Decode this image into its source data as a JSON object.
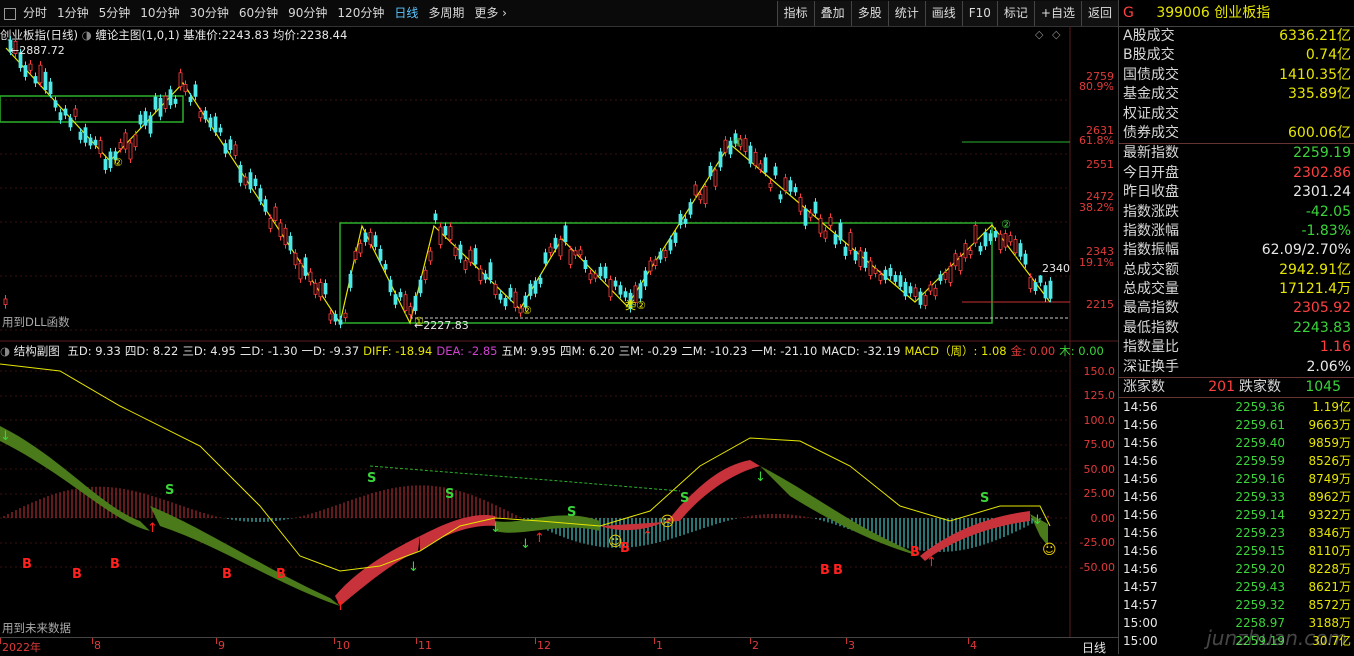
{
  "toolbar": {
    "periods": [
      "分时",
      "1分钟",
      "5分钟",
      "10分钟",
      "30分钟",
      "60分钟",
      "90分钟",
      "120分钟",
      "日线",
      "多周期",
      "更多"
    ],
    "active_period": "日线",
    "buttons": [
      "指标",
      "叠加",
      "多股",
      "统计",
      "画线",
      "F10",
      "标记",
      "+自选",
      "返回"
    ]
  },
  "main_chart": {
    "title": "创业板指(日线)",
    "indicator": "缠论主图(1,0,1)",
    "base_price_label": "基准价:",
    "base_price": "2243.83",
    "avg_label": "均价:",
    "avg_price": "2238.44",
    "high_mark": "2887.72",
    "low_mark": "2227.83",
    "last_price_tag": "2340",
    "price_axis": [
      "2759",
      "2631",
      "2551",
      "2472",
      "2343",
      "2215"
    ],
    "pct_axis": [
      "80.9%",
      "61.8%",
      "38.2%",
      "19.1%"
    ],
    "dll_note": "用到DLL函数",
    "zigzag_marks": [
      "②",
      "①",
      "②",
      "②",
      "类②",
      "①",
      "②"
    ]
  },
  "sub_chart": {
    "title": "结构副图",
    "items": [
      {
        "label": "五D:",
        "value": "9.33",
        "color": "#e6e6e6"
      },
      {
        "label": "四D:",
        "value": "8.22",
        "color": "#e6e6e6"
      },
      {
        "label": "三D:",
        "value": "4.95",
        "color": "#e6e6e6"
      },
      {
        "label": "二D:",
        "value": "-1.30",
        "color": "#e6e6e6"
      },
      {
        "label": "一D:",
        "value": "-9.37",
        "color": "#e6e6e6"
      },
      {
        "label": "DIFF:",
        "value": "-18.94",
        "color": "#e6e600"
      },
      {
        "label": "DEA:",
        "value": "-2.85",
        "color": "#d040d0"
      },
      {
        "label": "五M:",
        "value": "9.95",
        "color": "#e6e6e6"
      },
      {
        "label": "四M:",
        "value": "6.20",
        "color": "#e6e6e6"
      },
      {
        "label": "三M:",
        "value": "-0.29",
        "color": "#e6e6e6"
      },
      {
        "label": "二M:",
        "value": "-10.23",
        "color": "#e6e6e6"
      },
      {
        "label": "一M:",
        "value": "-21.10",
        "color": "#e6e6e6"
      },
      {
        "label": "MACD:",
        "value": "-32.19",
        "color": "#e6e6e6"
      },
      {
        "label": "MACD（周）:",
        "value": "1.08",
        "color": "#e6e600"
      },
      {
        "label": "金:",
        "value": "0.00",
        "color": "#e03a3a"
      },
      {
        "label": "木:",
        "value": "0.00",
        "color": "#3ad43a"
      }
    ],
    "axis": [
      "150.0",
      "125.0",
      "100.0",
      "75.00",
      "50.00",
      "25.00",
      "0.00",
      "-25.00",
      "-50.00"
    ],
    "future_note": "用到未来数据"
  },
  "time_axis": {
    "labels": [
      "2022年",
      "8",
      "9",
      "10",
      "11",
      "12",
      "1",
      "2",
      "3",
      "4"
    ],
    "period_label": "日线"
  },
  "right_panel": {
    "code_prefix": "G",
    "code": "399006",
    "name": "创业板指",
    "market_rows": [
      {
        "label": "A股成交",
        "value": "6336.21亿",
        "color": "#e6e600"
      },
      {
        "label": "B股成交",
        "value": "0.74亿",
        "color": "#e6e600"
      },
      {
        "label": "国债成交",
        "value": "1410.35亿",
        "color": "#e6e600"
      },
      {
        "label": "基金成交",
        "value": "335.89亿",
        "color": "#e6e600"
      },
      {
        "label": "权证成交",
        "value": "",
        "color": "#e6e600"
      },
      {
        "label": "债券成交",
        "value": "600.06亿",
        "color": "#e6e600"
      }
    ],
    "quote_rows": [
      {
        "label": "最新指数",
        "value": "2259.19",
        "color": "#3ad43a"
      },
      {
        "label": "今日开盘",
        "value": "2302.86",
        "color": "#ff4040"
      },
      {
        "label": "昨日收盘",
        "value": "2301.24",
        "color": "#e8e8e8"
      },
      {
        "label": "指数涨跌",
        "value": "-42.05",
        "color": "#3ad43a"
      },
      {
        "label": "指数涨幅",
        "value": "-1.83%",
        "color": "#3ad43a"
      },
      {
        "label": "指数振幅",
        "value": "62.09/2.70%",
        "color": "#e8e8e8"
      },
      {
        "label": "总成交额",
        "value": "2942.91亿",
        "color": "#e6e600"
      },
      {
        "label": "总成交量",
        "value": "17121.4万",
        "color": "#e6e600"
      },
      {
        "label": "最高指数",
        "value": "2305.92",
        "color": "#ff4040"
      },
      {
        "label": "最低指数",
        "value": "2243.83",
        "color": "#3ad43a"
      },
      {
        "label": "指数量比",
        "value": "1.16",
        "color": "#ff4040"
      },
      {
        "label": "深证换手",
        "value": "2.06%",
        "color": "#e8e8e8"
      }
    ],
    "up_label": "涨家数",
    "up_count": "201",
    "down_label": "跌家数",
    "down_count": "1045",
    "ticks": [
      {
        "time": "14:56",
        "price": "2259.36",
        "vol": "1.19亿"
      },
      {
        "time": "14:56",
        "price": "2259.61",
        "vol": "9663万"
      },
      {
        "time": "14:56",
        "price": "2259.40",
        "vol": "9859万"
      },
      {
        "time": "14:56",
        "price": "2259.59",
        "vol": "8526万"
      },
      {
        "time": "14:56",
        "price": "2259.16",
        "vol": "8749万"
      },
      {
        "time": "14:56",
        "price": "2259.33",
        "vol": "8962万"
      },
      {
        "time": "14:56",
        "price": "2259.14",
        "vol": "9322万"
      },
      {
        "time": "14:56",
        "price": "2259.23",
        "vol": "8346万"
      },
      {
        "time": "14:56",
        "price": "2259.15",
        "vol": "8110万"
      },
      {
        "time": "14:56",
        "price": "2259.20",
        "vol": "8228万"
      },
      {
        "time": "14:57",
        "price": "2259.43",
        "vol": "8621万"
      },
      {
        "time": "14:57",
        "price": "2259.32",
        "vol": "8572万"
      },
      {
        "time": "15:00",
        "price": "2258.97",
        "vol": "3188万"
      },
      {
        "time": "15:00",
        "price": "2259.19",
        "vol": "30.7亿"
      }
    ],
    "watermark": "junzhuan.com"
  },
  "colors": {
    "up": "#ff4040",
    "down": "#3ad43a",
    "kline_down": "#4ee8e8",
    "volume_green": "#4a7a1a",
    "fill_red": "#c8323a"
  }
}
